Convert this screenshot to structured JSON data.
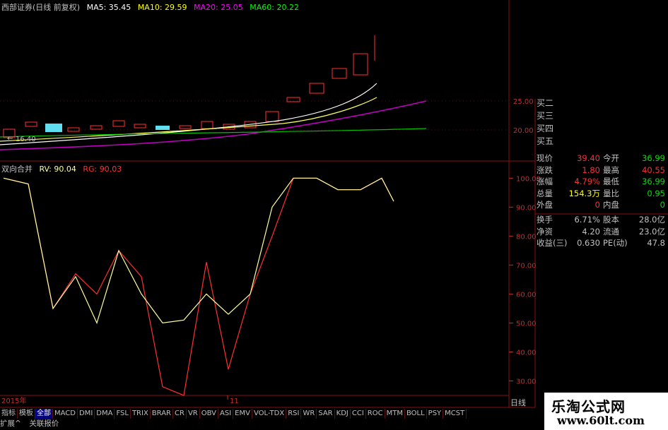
{
  "header": {
    "stock": "西部证券(日线 前复权)",
    "ma": [
      {
        "label": "MA5: 35.45",
        "color": "#ffffff"
      },
      {
        "label": "MA10: 29.59",
        "color": "#ffff00"
      },
      {
        "label": "MA20: 25.05",
        "color": "#ff00ff"
      },
      {
        "label": "MA60: 20.22",
        "color": "#00ff00"
      }
    ]
  },
  "price_axis": [
    "25.00",
    "20.00"
  ],
  "low_marker": "16.40",
  "indicator": {
    "name": "双向合并",
    "rv": "RV: 90.04",
    "rg": "RG: 90.03",
    "rv_color": "#ffffa0",
    "rg_color": "#ff3030"
  },
  "indicator_axis": [
    "100.00",
    "90.00",
    "80.00",
    "70.00",
    "60.00",
    "50.00",
    "40.00",
    "30.00"
  ],
  "time_labels": {
    "year": "2015年",
    "month": "11"
  },
  "buy_labels": [
    "买二",
    "买三",
    "买四",
    "买五"
  ],
  "quote": [
    {
      "l1": "现价",
      "v1": "39.40",
      "c1": "#ff3030",
      "l2": "今开",
      "v2": "36.99",
      "c2": "#00e000"
    },
    {
      "l1": "涨跌",
      "v1": "1.80",
      "c1": "#ff3030",
      "l2": "最高",
      "v2": "40.55",
      "c2": "#ff3030"
    },
    {
      "l1": "涨幅",
      "v1": "4.79%",
      "c1": "#ff3030",
      "l2": "最低",
      "v2": "36.99",
      "c2": "#00e000"
    },
    {
      "l1": "总量",
      "v1": "154.3万",
      "c1": "#ffff00",
      "l2": "量比",
      "v2": "0.95",
      "c2": "#00e000"
    },
    {
      "l1": "外盘",
      "v1": "0",
      "c1": "#ff3030",
      "l2": "内盘",
      "v2": "0",
      "c2": "#00e000"
    },
    {
      "l1": "换手",
      "v1": "6.71%",
      "c1": "#c0c0c0",
      "l2": "股本",
      "v2": "28.0亿",
      "c2": "#c0c0c0"
    },
    {
      "l1": "净资",
      "v1": "4.20",
      "c1": "#c0c0c0",
      "l2": "流通",
      "v2": "23.0亿",
      "c2": "#c0c0c0"
    },
    {
      "l1": "收益(三)",
      "v1": "0.630",
      "c1": "#c0c0c0",
      "l2": "PE(动)",
      "v2": "47.8",
      "c2": "#c0c0c0"
    }
  ],
  "tabs": [
    "指标",
    "模板",
    "全部",
    "MACD",
    "DMI",
    "DMA",
    "FSL",
    "TRIX",
    "BRAR",
    "CR",
    "VR",
    "OBV",
    "ASI",
    "EMV",
    "VOL-TDX",
    "RSI",
    "WR",
    "SAR",
    "KDJ",
    "CCI",
    "ROC",
    "MTM",
    "BOLL",
    "PSY",
    "MCST"
  ],
  "active_tab": 2,
  "bottom_bar": [
    "扩展^",
    "关联报价"
  ],
  "daily_label": "日线",
  "watermark": {
    "line1": "乐淘公式网",
    "line2": "www.60lt.com"
  },
  "chart_data": {
    "type": "line",
    "series": [
      {
        "name": "RV",
        "values": [
          100,
          98,
          55,
          66,
          50,
          75,
          60,
          50,
          51,
          60,
          53,
          60,
          90,
          100,
          100,
          96,
          96,
          100,
          92
        ]
      },
      {
        "name": "RG",
        "values": [
          100,
          98,
          55,
          67,
          60,
          75,
          66,
          28,
          25,
          71,
          34,
          60,
          80,
          100,
          100,
          96,
          96,
          100,
          92
        ]
      }
    ],
    "ylim": [
      25,
      103
    ]
  }
}
